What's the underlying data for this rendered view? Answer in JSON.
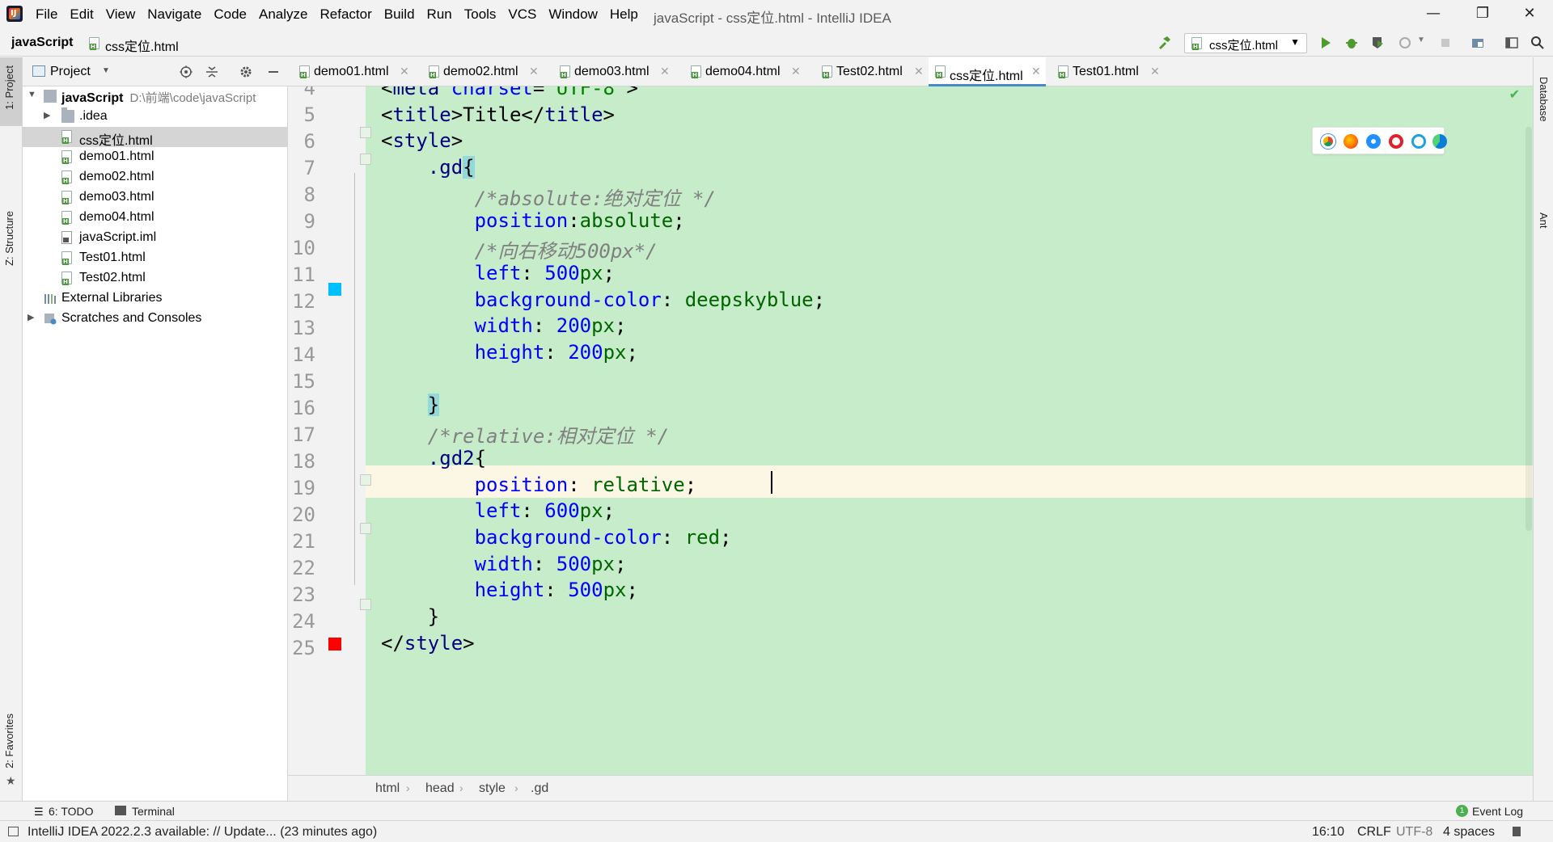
{
  "window": {
    "title": "javaScript - css定位.html - IntelliJ IDEA",
    "logo_text": "IJ",
    "menu": [
      "File",
      "Edit",
      "View",
      "Navigate",
      "Code",
      "Analyze",
      "Refactor",
      "Build",
      "Run",
      "Tools",
      "VCS",
      "Window",
      "Help"
    ],
    "minimize": "—",
    "restore": "❐",
    "close": "✕"
  },
  "navbar": {
    "project": "javaScript",
    "file": "css定位.html",
    "run_config": "css定位.html"
  },
  "left_strip": {
    "project_tab": "1: Project",
    "structure_tab": "Z: Structure",
    "favorites_tab": "2: Favorites"
  },
  "right_strip": {
    "database_tab": "Database",
    "ant_tab": "Ant"
  },
  "project_panel": {
    "title": "Project",
    "root": {
      "name": "javaScript",
      "path": "D:\\前端\\code\\javaScript"
    },
    "items": [
      {
        "name": ".idea",
        "type": "folder"
      },
      {
        "name": "css定位.html",
        "type": "html",
        "selected": true
      },
      {
        "name": "demo01.html",
        "type": "html"
      },
      {
        "name": "demo02.html",
        "type": "html"
      },
      {
        "name": "demo03.html",
        "type": "html"
      },
      {
        "name": "demo04.html",
        "type": "html"
      },
      {
        "name": "javaScript.iml",
        "type": "iml"
      },
      {
        "name": "Test01.html",
        "type": "html"
      },
      {
        "name": "Test02.html",
        "type": "html"
      }
    ],
    "external_libraries": "External Libraries",
    "scratches": "Scratches and Consoles"
  },
  "tabs": [
    {
      "label": "demo01.html",
      "active": false
    },
    {
      "label": "demo02.html",
      "active": false
    },
    {
      "label": "demo03.html",
      "active": false
    },
    {
      "label": "demo04.html",
      "active": false
    },
    {
      "label": "Test02.html",
      "active": false
    },
    {
      "label": "css定位.html",
      "active": true
    },
    {
      "label": "Test01.html",
      "active": false
    }
  ],
  "editor": {
    "line_numbers": [
      "4",
      "5",
      "6",
      "7",
      "8",
      "9",
      "10",
      "11",
      "12",
      "13",
      "14",
      "15",
      "16",
      "17",
      "18",
      "19",
      "20",
      "21",
      "22",
      "23",
      "24",
      "25"
    ],
    "swatch_colors": {
      "line12": "#00bfff",
      "line21": "#ff0000"
    },
    "caret_position": "16:10"
  },
  "breadcrumb": [
    "html",
    "head",
    "style",
    ".gd"
  ],
  "bottom_tools": {
    "todo": "6: TODO",
    "terminal": "Terminal",
    "event_log": "Event Log",
    "event_count": "1"
  },
  "status": {
    "message": "IntelliJ IDEA 2022.2.3 available: // Update... (23 minutes ago)",
    "position": "16:10",
    "line_sep": "CRLF",
    "encoding": "UTF-8",
    "indent": "4 spaces"
  }
}
